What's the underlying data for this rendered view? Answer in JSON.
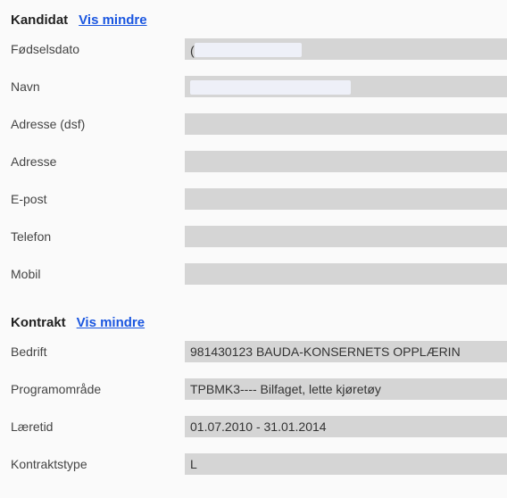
{
  "kandidat": {
    "title": "Kandidat",
    "toggle_label": "Vis mindre",
    "fields": {
      "fodselsdato": {
        "label": "Fødselsdato",
        "value": ""
      },
      "navn": {
        "label": "Navn",
        "value": ""
      },
      "adresse_dsf": {
        "label": "Adresse (dsf)",
        "value": ""
      },
      "adresse": {
        "label": "Adresse",
        "value": ""
      },
      "epost": {
        "label": "E-post",
        "value": ""
      },
      "telefon": {
        "label": "Telefon",
        "value": ""
      },
      "mobil": {
        "label": "Mobil",
        "value": ""
      }
    }
  },
  "kontrakt": {
    "title": "Kontrakt",
    "toggle_label": "Vis mindre",
    "fields": {
      "bedrift": {
        "label": "Bedrift",
        "value": "981430123 BAUDA-KONSERNETS OPPLÆRIN"
      },
      "programomrade": {
        "label": "Programområde",
        "value": "TPBMK3---- Bilfaget, lette kjøretøy"
      },
      "laeretid": {
        "label": "Læretid",
        "value": "01.07.2010 - 31.01.2014"
      },
      "kontraktstype": {
        "label": "Kontraktstype",
        "value": "L"
      }
    }
  }
}
